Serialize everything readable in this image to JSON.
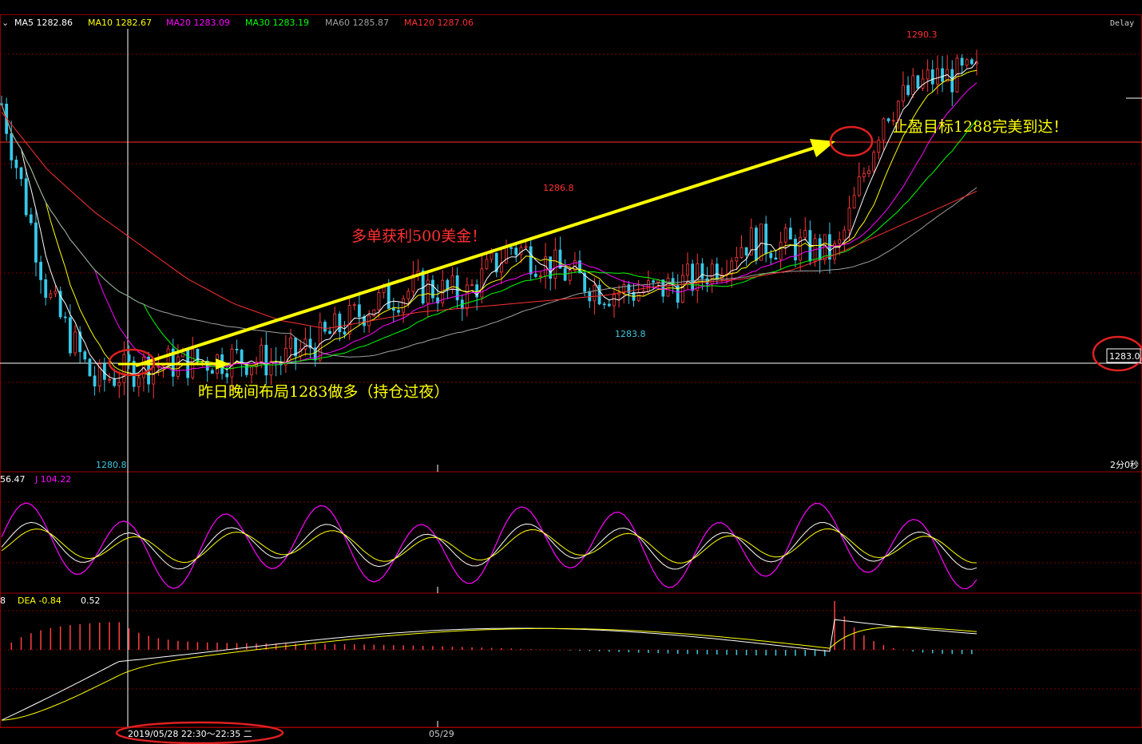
{
  "chart_data": {
    "type": "line",
    "title": "",
    "instrument_note": "Delay",
    "price_panel": {
      "ma_legend": [
        {
          "label": "MA5 1282.86",
          "color": "#ffffff"
        },
        {
          "label": "MA10 1282.67",
          "color": "#ffff00"
        },
        {
          "label": "MA20 1283.09",
          "color": "#ff00ff"
        },
        {
          "label": "MA30 1283.19",
          "color": "#00ff00"
        },
        {
          "label": "MA60 1285.87",
          "color": "#a0a0a0"
        },
        {
          "label": "MA120 1287.06",
          "color": "#ff3030"
        }
      ],
      "price_marks": {
        "high": "1290.3",
        "mid_high": "1286.8",
        "mid_low": "1283.8",
        "low": "1280.8"
      },
      "right_price_tag": "1283.0",
      "corner_note": "2分0秒",
      "annotations": {
        "entry": "昨日晚间布局1283做多（持仓过夜）",
        "profit": "多单获利500美金！",
        "target": "止盈目标1288完美到达！"
      },
      "ylim": [
        1280.5,
        1291.0
      ],
      "ma5_approx": [
        1289.2,
        1284.6,
        1282.5,
        1282.9,
        1283.0,
        1283.1,
        1283.0,
        1283.6,
        1284.4,
        1284.8,
        1284.6,
        1285.8,
        1285.2,
        1284.7,
        1284.7,
        1285.0,
        1285.9,
        1285.8,
        1285.6,
        1289.0,
        1289.8,
        1289.9
      ],
      "ma120_approx": [
        1289.0,
        1287.6,
        1286.6,
        1285.8,
        1285.0,
        1284.4,
        1284.0,
        1283.8,
        1284.0,
        1284.2,
        1284.3,
        1284.4,
        1284.5,
        1284.6,
        1284.8,
        1284.9,
        1285.0,
        1285.2,
        1285.6,
        1286.1,
        1286.6,
        1287.1
      ]
    },
    "kdj_panel": {
      "legend": [
        "56.47",
        "J 104.22"
      ]
    },
    "macd_panel": {
      "legend": [
        "8",
        "DEA -0.84",
        "0.52"
      ]
    },
    "time_axis": {
      "labels": [
        "05/29"
      ],
      "crosshair_time": "2019/05/28 22:30～22:35 二"
    }
  }
}
